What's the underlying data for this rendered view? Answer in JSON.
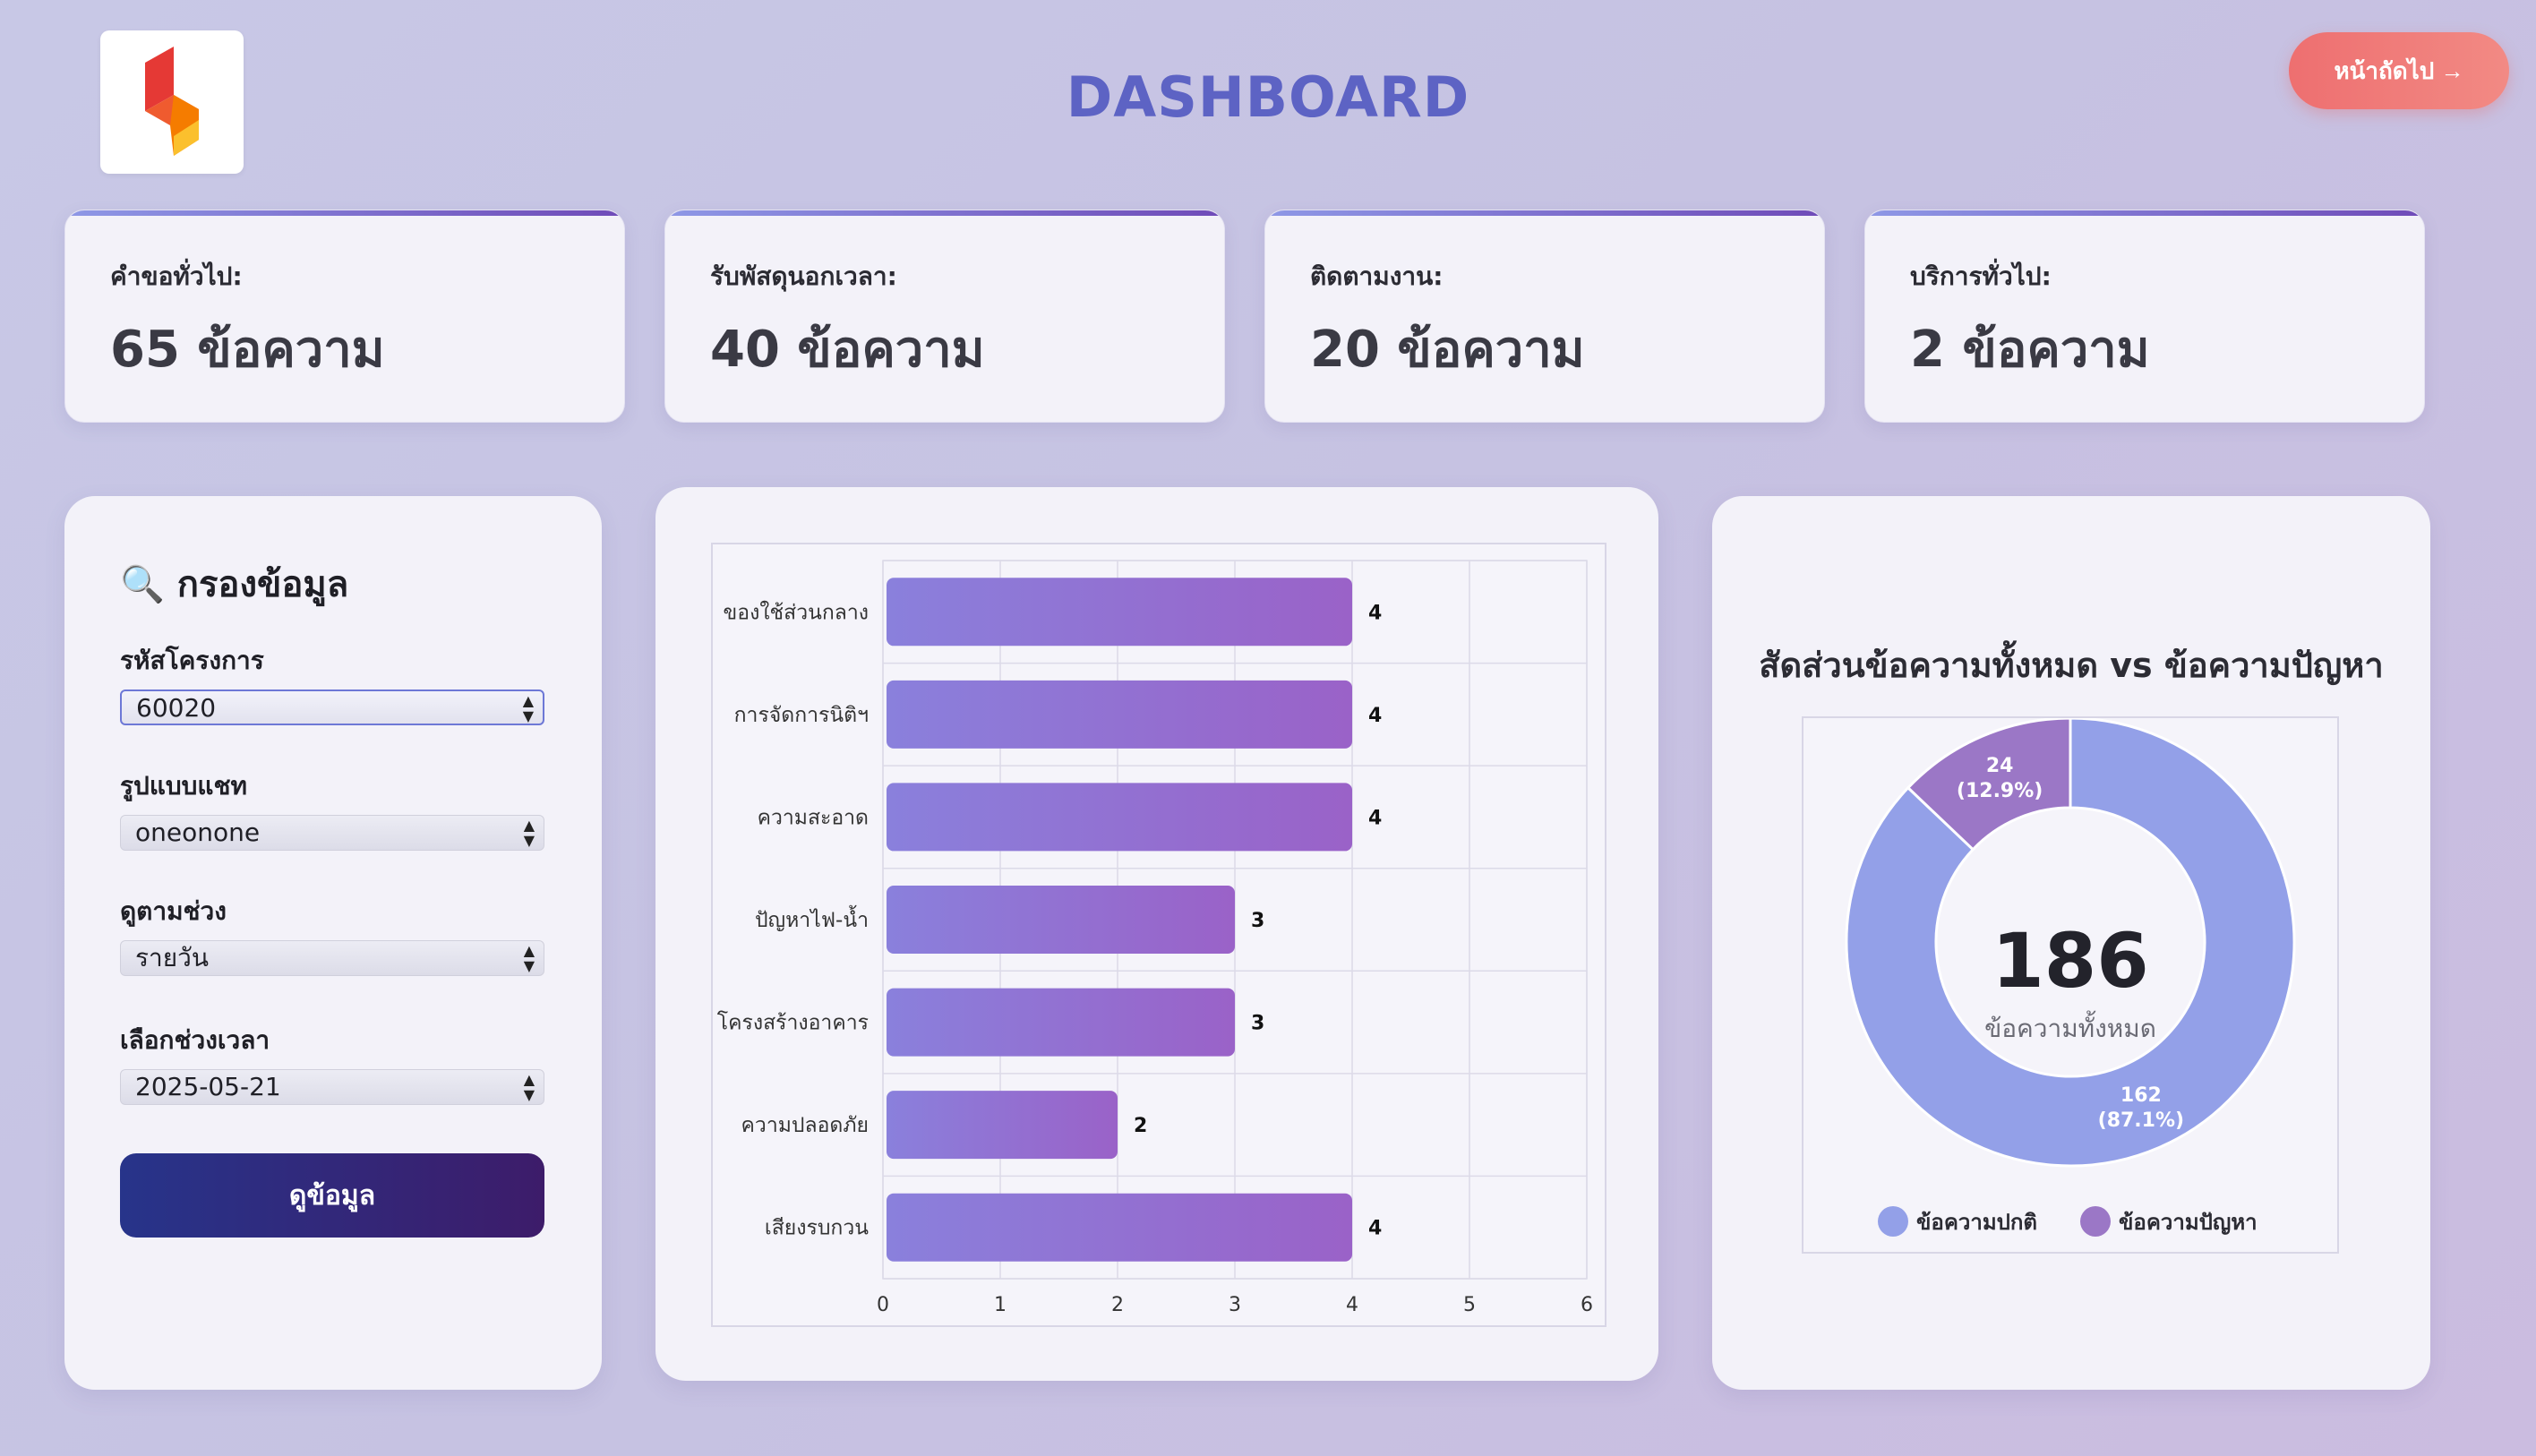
{
  "header": {
    "title": "DASHBOARD",
    "next_label": "หน้าถัดไป →"
  },
  "logo": {
    "colors": [
      "#e53935",
      "#f57c00",
      "#fbc02d"
    ]
  },
  "stats": [
    {
      "label": "คำขอทั่วไป:",
      "value": "65 ข้อความ"
    },
    {
      "label": "รับพัสดุนอกเวลา:",
      "value": "40 ข้อความ"
    },
    {
      "label": "ติดตามงาน:",
      "value": "20 ข้อความ"
    },
    {
      "label": "บริการทั่วไป:",
      "value": "2 ข้อความ"
    }
  ],
  "filter": {
    "title": "🔍 กรองข้อมูล",
    "project_label": "รหัสโครงการ",
    "project_value": "60020",
    "chat_label": "รูปแบบแชท",
    "chat_value": "oneonone",
    "range_label": "ดูตามช่วง",
    "range_value": "รายวัน",
    "period_label": "เลือกช่วงเวลา",
    "period_value": "2025-05-21",
    "view_button": "ดูข้อมูล"
  },
  "chart_data": [
    {
      "type": "bar",
      "orientation": "horizontal",
      "categories": [
        "ของใช้ส่วนกลาง",
        "การจัดการนิติฯ",
        "ความสะอาด",
        "ปัญหาไฟ-น้ำ",
        "โครงสร้างอาคาร",
        "ความปลอดภัย",
        "เสียงรบกวน"
      ],
      "values": [
        4,
        4,
        4,
        3,
        3,
        2,
        4
      ],
      "xlim": [
        0,
        6
      ],
      "xticks": [
        "0",
        "1",
        "2",
        "3",
        "4",
        "5",
        "6"
      ],
      "grid": true,
      "color": "#8f73d4"
    },
    {
      "type": "pie",
      "title": "สัดส่วนข้อความทั้งหมด vs ข้อความปัญหา",
      "center_value": "186",
      "center_label": "ข้อความทั้งหมด",
      "slices": [
        {
          "name": "ข้อความปกติ",
          "value": 162,
          "label_top": "162",
          "label_bottom": "(87.1%)",
          "color": "#93a0e8"
        },
        {
          "name": "ข้อความปัญหา",
          "value": 24,
          "label_top": "24",
          "label_bottom": "(12.9%)",
          "color": "#9b77c6"
        }
      ],
      "legend_position": "bottom"
    }
  ]
}
